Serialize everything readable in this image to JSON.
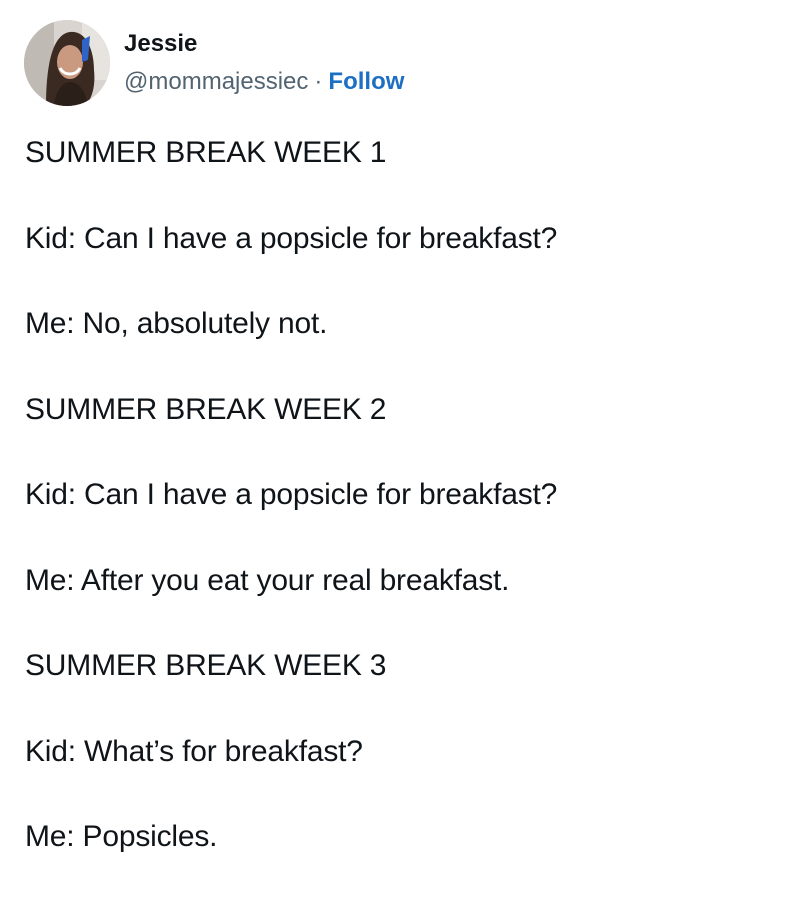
{
  "author": {
    "display_name": "Jessie",
    "handle": "@mommajessiec",
    "separator": "·",
    "follow_label": "Follow",
    "avatar_icon": "profile-photo-avatar"
  },
  "tweet": {
    "lines": [
      "SUMMER BREAK WEEK 1",
      "Kid: Can I have a popsicle for breakfast?",
      "Me: No, absolutely not.",
      "SUMMER BREAK WEEK 2",
      "Kid: Can I have a popsicle for breakfast?",
      "Me: After you eat your real breakfast.",
      "SUMMER BREAK WEEK 3",
      "Kid: What’s for breakfast?",
      "Me: Popsicles."
    ]
  },
  "colors": {
    "link": "#1d6fc4",
    "text": "#0f1419",
    "secondary": "#536471"
  }
}
